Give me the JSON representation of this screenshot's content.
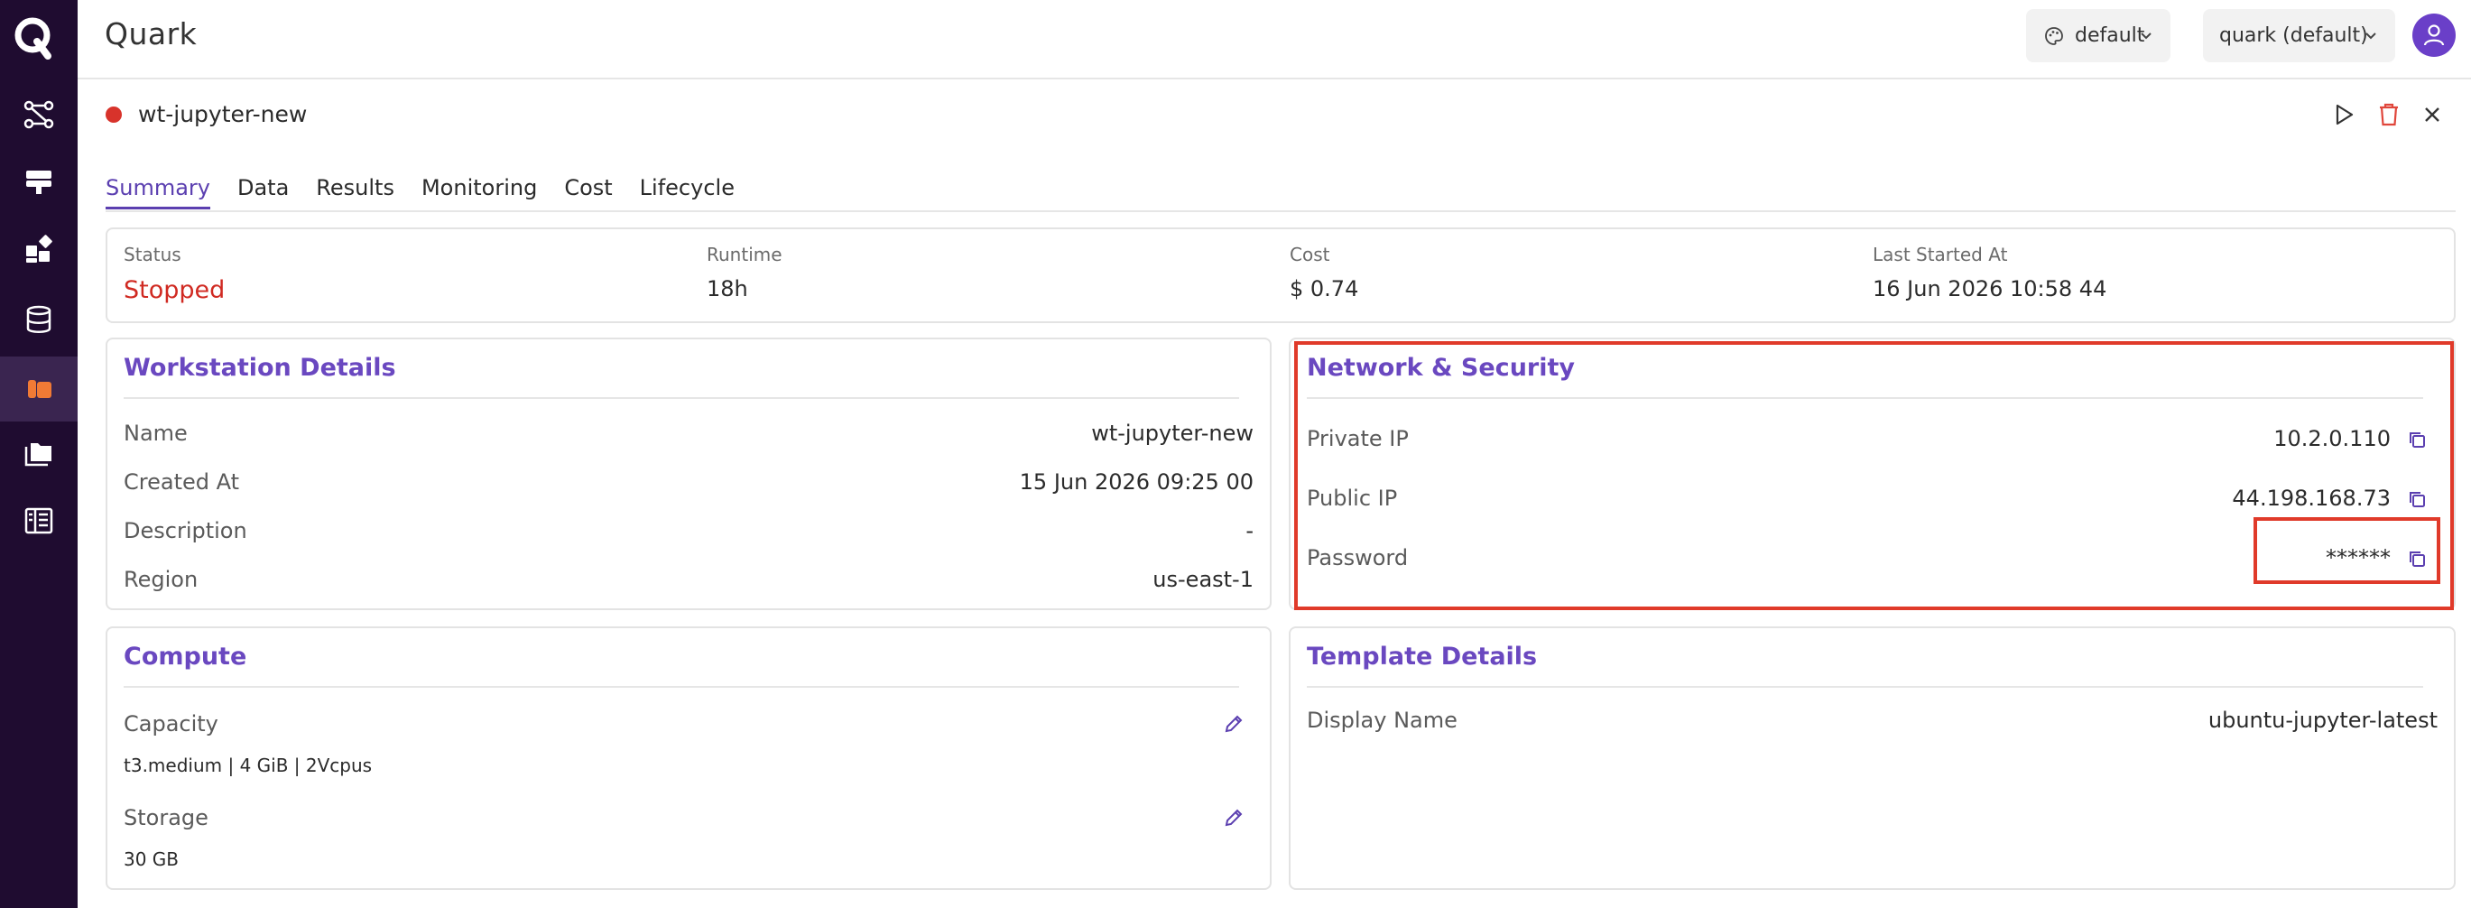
{
  "app": {
    "title": "Quark",
    "theme_dropdown": "default",
    "workspace_dropdown": "quark (default)"
  },
  "sidebar": {
    "items": [
      {
        "icon": "workflow-icon"
      },
      {
        "icon": "server-icon"
      },
      {
        "icon": "apps-icon"
      },
      {
        "icon": "database-icon"
      },
      {
        "icon": "workstation-icon",
        "active": true
      },
      {
        "icon": "folder-icon"
      },
      {
        "icon": "table-icon"
      }
    ]
  },
  "workstation": {
    "name": "wt-jupyter-new",
    "status_color": "#d8332b"
  },
  "tabs": [
    {
      "label": "Summary",
      "active": true
    },
    {
      "label": "Data"
    },
    {
      "label": "Results"
    },
    {
      "label": "Monitoring"
    },
    {
      "label": "Cost"
    },
    {
      "label": "Lifecycle"
    }
  ],
  "summary": {
    "status_label": "Status",
    "status_value": "Stopped",
    "runtime_label": "Runtime",
    "runtime_value": "18h",
    "cost_label": "Cost",
    "cost_value": "$ 0.74",
    "last_started_label": "Last Started At",
    "last_started_value": "16 Jun 2026 10:58 44"
  },
  "workstation_details": {
    "title": "Workstation Details",
    "rows": [
      {
        "label": "Name",
        "value": "wt-jupyter-new"
      },
      {
        "label": "Created At",
        "value": "15 Jun 2026 09:25 00"
      },
      {
        "label": "Description",
        "value": "-"
      },
      {
        "label": "Region",
        "value": "us-east-1"
      }
    ]
  },
  "network_security": {
    "title": "Network & Security",
    "rows": [
      {
        "label": "Private IP",
        "value": "10.2.0.110"
      },
      {
        "label": "Public IP",
        "value": "44.198.168.73"
      },
      {
        "label": "Password",
        "value": "******"
      }
    ]
  },
  "compute": {
    "title": "Compute",
    "capacity_label": "Capacity",
    "capacity_value": "t3.medium | 4 GiB | 2Vcpus",
    "storage_label": "Storage",
    "storage_value": "30 GB"
  },
  "template_details": {
    "title": "Template Details",
    "display_name_label": "Display Name",
    "display_name_value": "ubuntu-jupyter-latest"
  },
  "colors": {
    "sidebar_bg": "#1f0c30",
    "accent": "#6a48c0",
    "stopped": "#d02a22",
    "highlight": "#e03a2a",
    "active_nav_icon": "#f07a35"
  }
}
